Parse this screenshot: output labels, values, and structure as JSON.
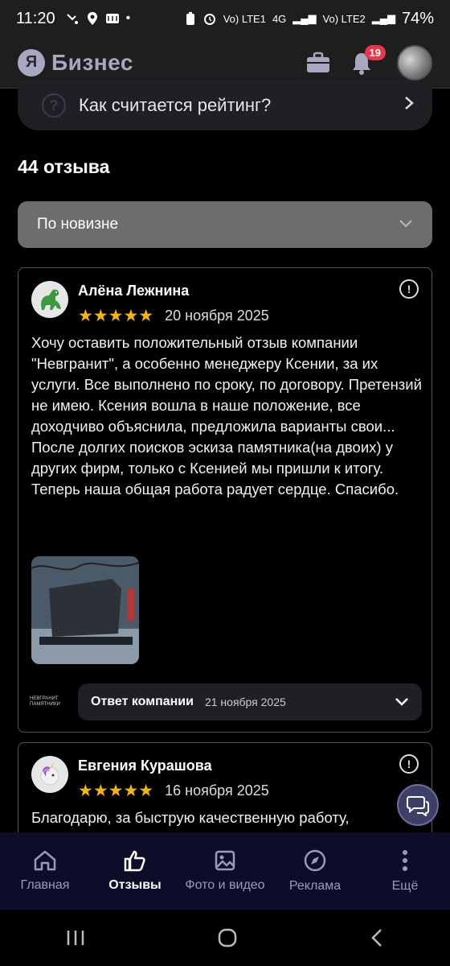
{
  "status_bar": {
    "time": "11:20",
    "battery": "74%",
    "net1": "Vo) LTE1",
    "net2": "4G",
    "net3": "Vo) LTE2"
  },
  "header": {
    "logo_letter": "Я",
    "logo_text": "Бизнес",
    "notification_count": "19"
  },
  "rating_info": {
    "label": "Как считается рейтинг?"
  },
  "reviews_count": "44 отзыва",
  "sort": {
    "selected": "По новизне"
  },
  "reviews": [
    {
      "author": "Алёна Лежнина",
      "stars": 5,
      "stars_text": "★★★★★",
      "date": "20 ноября 2025",
      "text": "Хочу оставить положительный отзыв компании \"Невгранит\", а особенно менеджеру Ксении, за их услуги. Все выполнено по сроку, по договору. Претензий не имею. Ксения вошла в наше положение, все доходчиво объяснила, предложила варианты свои... После долгих поисков эскиза памятника(на двоих) у других фирм, только с Ксенией мы пришли к итогу. Теперь наша общая работа радует сердце. Спасибо.",
      "company_logo_text": "НЕВГРАНИТ ПАМЯТНИКИ",
      "answer_label": "Ответ компании",
      "answer_date": "21 ноября 2025"
    },
    {
      "author": "Евгения Курашова",
      "stars": 5,
      "stars_text": "★★★★★",
      "date": "16 ноября 2025",
      "text": "Благодарю, за быструю качественную работу,"
    }
  ],
  "bottom_nav": [
    {
      "label": "Главная",
      "icon": "home-icon"
    },
    {
      "label": "Отзывы",
      "icon": "thumbs-up-icon",
      "active": true
    },
    {
      "label": "Фото и видео",
      "icon": "image-icon"
    },
    {
      "label": "Реклама",
      "icon": "compass-icon"
    },
    {
      "label": "Ещё",
      "icon": "more-vertical-icon"
    }
  ],
  "colors": {
    "accent": "#a7a7c0",
    "star": "#f5b800",
    "badge": "#e8374b",
    "nav_bg": "#0d0d2a"
  }
}
